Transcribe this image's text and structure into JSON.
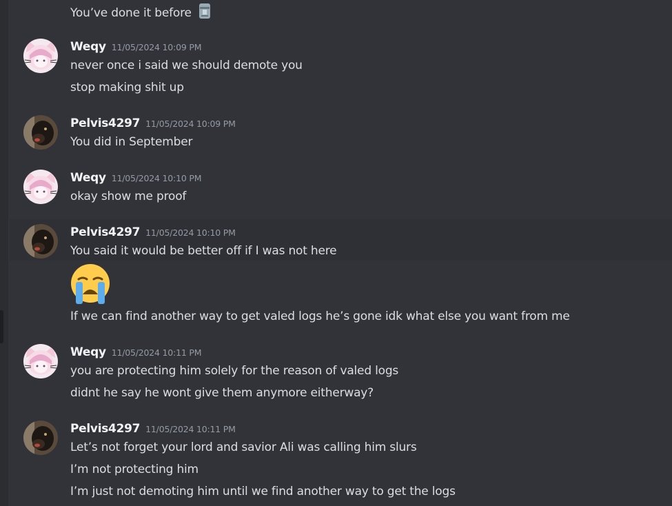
{
  "messages": [
    {
      "lines": [
        "You’ve done it before"
      ],
      "emoji": "moai-icon"
    },
    {
      "author": "Weqy",
      "timestamp": "11/05/2024 10:09 PM",
      "lines": [
        "never once i said we should demote you",
        "stop making shit up"
      ]
    },
    {
      "author": "Pelvis4297",
      "timestamp": "11/05/2024 10:09 PM",
      "lines": [
        "You did in September"
      ]
    },
    {
      "author": "Weqy",
      "timestamp": "11/05/2024 10:10 PM",
      "lines": [
        "okay show me proof"
      ]
    },
    {
      "author": "Pelvis4297",
      "timestamp": "11/05/2024 10:10 PM",
      "lines": [
        "You said it would be better off if I was not here",
        "If we can find another way to get valed logs he’s gone idk what else you want from me"
      ],
      "big_emoji": "loudly-crying-face-icon"
    },
    {
      "author": "Weqy",
      "timestamp": "11/05/2024 10:11 PM",
      "lines": [
        "you are protecting him solely for the reason of valed logs",
        "didnt he say he wont give them anymore eitherway?"
      ]
    },
    {
      "author": "Pelvis4297",
      "timestamp": "11/05/2024 10:11 PM",
      "lines": [
        "Let’s not forget your lord and savior Ali was calling him slurs",
        "I’m not protecting him",
        "I’m just not demoting him until we find another way to get the logs"
      ]
    }
  ],
  "colors": {
    "background": "#313338",
    "username": "#f2f3f5",
    "timestamp": "#949ba4",
    "text": "#dbdee1"
  }
}
